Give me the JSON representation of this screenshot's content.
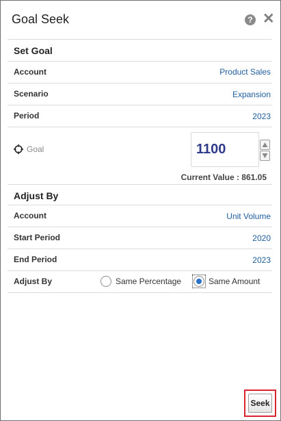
{
  "dialog": {
    "title": "Goal Seek",
    "help_icon": "question-mark-icon",
    "close_icon": "close-icon"
  },
  "set_goal": {
    "heading": "Set Goal",
    "rows": [
      {
        "label": "Account",
        "value": "Product Sales"
      },
      {
        "label": "Scenario",
        "value": "Expansion"
      },
      {
        "label": "Period",
        "value": "2023"
      }
    ],
    "goal": {
      "label": "Goal",
      "value": "1100",
      "current_value_text": "Current Value : 861.05"
    }
  },
  "adjust_by": {
    "heading": "Adjust By",
    "rows": [
      {
        "label": "Account",
        "value": "Unit Volume"
      },
      {
        "label": "Start Period",
        "value": "2020"
      },
      {
        "label": "End Period",
        "value": "2023"
      }
    ],
    "method": {
      "label": "Adjust By",
      "options": [
        "Same Percentage",
        "Same Amount"
      ],
      "selected": "Same Amount"
    }
  },
  "footer": {
    "seek_label": "Seek"
  },
  "colors": {
    "link_value": "#1f5d9c",
    "goal_value": "#2f3a8a",
    "radio_selected": "#2a72c9",
    "highlight_frame": "#d9232d"
  }
}
